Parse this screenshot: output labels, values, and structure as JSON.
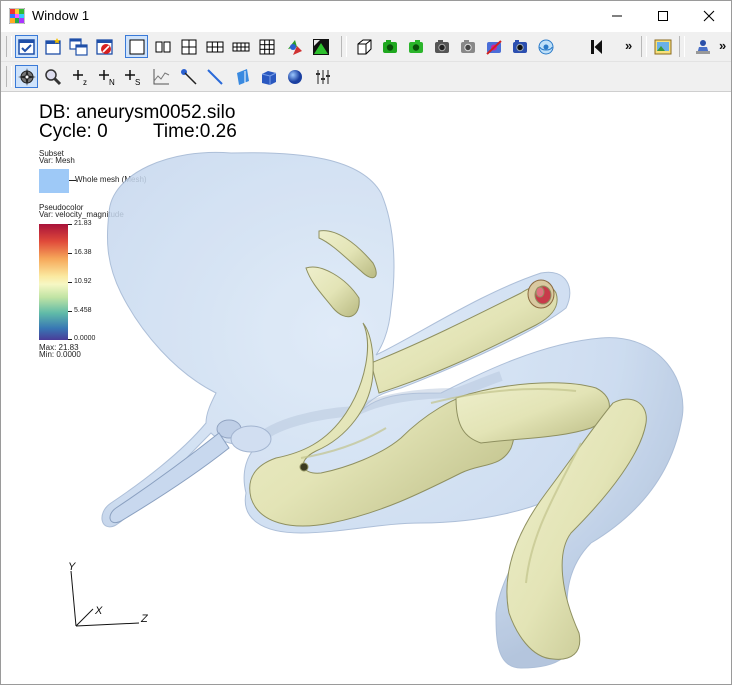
{
  "window": {
    "title": "Window 1"
  },
  "toolbar1": {
    "buttons": [
      "active-window",
      "new-window",
      "clone-window",
      "delete-window",
      "layout-1x1",
      "layout-1x2",
      "layout-2x2",
      "layout-2x3",
      "layout-3x2",
      "layout-3x3",
      "lock-view",
      "lock-time",
      "invert-background",
      "reset-view",
      "undo-view",
      "save-image",
      "print",
      "copy",
      "camera",
      "spin",
      "play-back",
      "help"
    ],
    "overflow": "»"
  },
  "toolbar2": {
    "buttons": [
      "navigate",
      "zoom",
      "lineout-z",
      "lineout-n",
      "lineout-s",
      "curve",
      "pick",
      "line",
      "box",
      "plane",
      "sphere",
      "axis-array"
    ],
    "overflow": "»"
  },
  "annotations": {
    "db": "DB: aneurysm0052.silo",
    "cycle": "Cycle: 0",
    "time": "Time:0.26"
  },
  "legend_subset": {
    "title": "Subset",
    "var": "Var: Mesh",
    "entry": "Whole mesh (Mesh)",
    "swatch_color": "#9ec9f7"
  },
  "legend_pseudocolor": {
    "title": "Pseudocolor",
    "var": "Var: velocity_magnitude",
    "ticks": [
      "21.83",
      "16.38",
      "10.92",
      "5.458",
      "0.0000"
    ],
    "max": "Max: 21.83",
    "min": "Min: 0.0000"
  },
  "axes": {
    "y": "Y",
    "x": "X",
    "z": "Z"
  },
  "colors": {
    "mesh": "#c7dbf3",
    "tube": "#e8e9c0",
    "tube_shadow": "#c9c994",
    "inner": "#c83a4a"
  }
}
